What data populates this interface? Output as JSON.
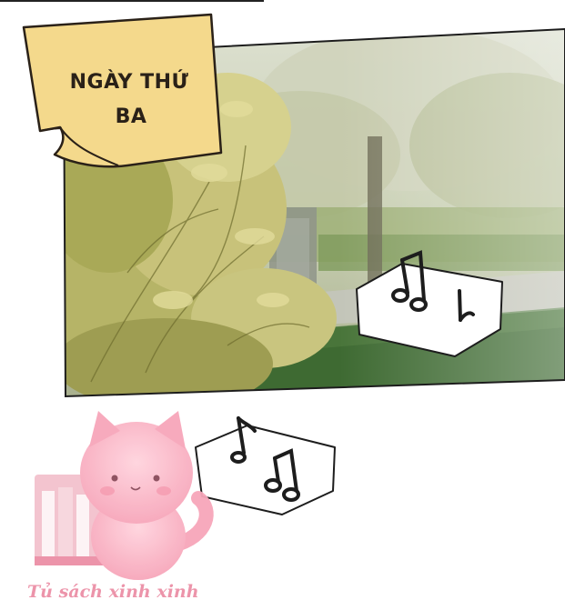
{
  "caption": {
    "line1": "NGÀY THỨ",
    "line2": "BA"
  },
  "watermark": {
    "text": "Tủ sách xinh xinh"
  },
  "icons": [
    "music-note-icon",
    "music-note-icon",
    "cat-mascot-icon",
    "bookshelf-icon"
  ],
  "colors": {
    "caption_paper": "#f4d98c",
    "watermark_pink": "#ec8fa6",
    "grass": "#3e6a32",
    "foliage": "#c8c27a"
  }
}
